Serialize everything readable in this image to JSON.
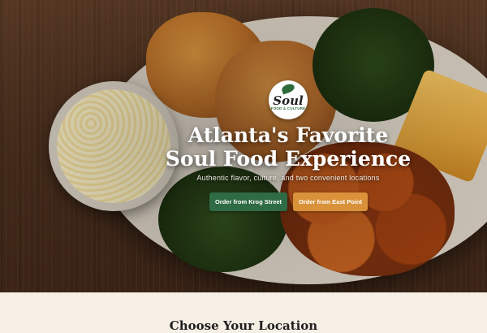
{
  "logo": {
    "word": "Soul",
    "subtitle": "FOOD & CULTURE"
  },
  "hero": {
    "headline_line1": "Atlanta's Favorite",
    "headline_line2": "Soul Food Experience",
    "tagline": "Authentic flavor, culture, and two convenient locations",
    "buttons": {
      "krog": "Order from Krog Street",
      "east_point": "Order from East Point"
    }
  },
  "colors": {
    "green_button": "#2f6b45",
    "orange_button": "#d9923a",
    "lower_background": "#f6efe6"
  },
  "lower": {
    "section_title": "Choose Your Location"
  }
}
